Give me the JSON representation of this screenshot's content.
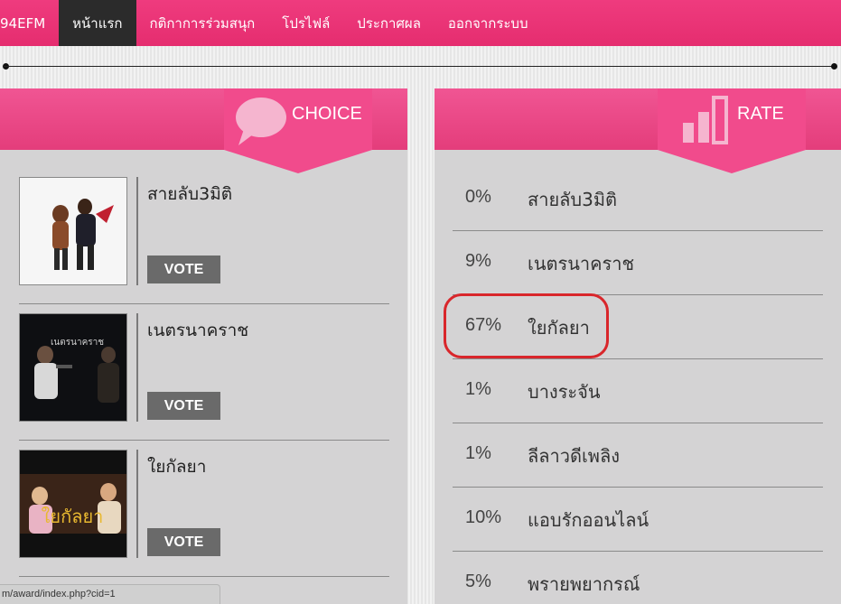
{
  "nav": {
    "brand": "94EFM",
    "items": [
      {
        "label": "หน้าแรก",
        "active": true
      },
      {
        "label": "กติกาการร่วมสนุก",
        "active": false
      },
      {
        "label": "โปรไฟล์",
        "active": false
      },
      {
        "label": "ประกาศผล",
        "active": false
      },
      {
        "label": "ออกจากระบบ",
        "active": false
      }
    ]
  },
  "choice_panel": {
    "title": "CHOICE",
    "items": [
      {
        "name": "สายลับ3มิติ",
        "vote_label": "VOTE"
      },
      {
        "name": "เนตรนาคราช",
        "vote_label": "VOTE"
      },
      {
        "name": "ใยกัลยา",
        "vote_label": "VOTE"
      }
    ]
  },
  "rate_panel": {
    "title": "RATE",
    "rows": [
      {
        "percent": "0%",
        "name": "สายลับ3มิติ"
      },
      {
        "percent": "9%",
        "name": "เนตรนาคราช"
      },
      {
        "percent": "67%",
        "name": "ใยกัลยา"
      },
      {
        "percent": "1%",
        "name": "บางระจัน"
      },
      {
        "percent": "1%",
        "name": "ลีลาวดีเพลิง"
      },
      {
        "percent": "10%",
        "name": "แอบรักออนไลน์"
      },
      {
        "percent": "5%",
        "name": "พรายพยากรณ์"
      }
    ]
  },
  "status_bar": {
    "url": "m/award/index.php?cid=1"
  },
  "colors": {
    "accent": "#e8336f",
    "nav_active": "#2b2b2b",
    "panel_bg": "#d4d3d4",
    "highlight": "#d9262b"
  }
}
